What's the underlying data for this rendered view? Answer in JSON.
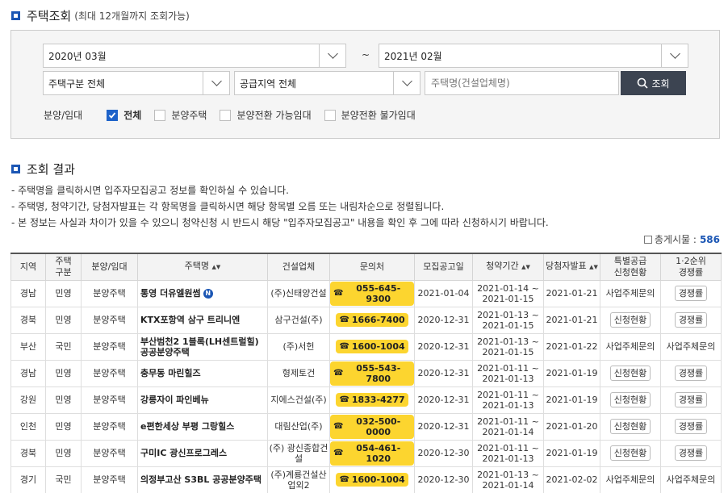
{
  "search": {
    "title": "주택조회",
    "subtitle": "(최대 12개월까지 조회가능)",
    "from_month": "2020년 03월",
    "tilde": "~",
    "to_month": "2021년 02월",
    "house_type": "주택구분 전체",
    "region": "공급지역 전체",
    "name_placeholder": "주택명(건설업체명)",
    "search_button": "조회",
    "filter_label": "분양/임대",
    "filters": [
      {
        "label": "전체",
        "checked": true
      },
      {
        "label": "분양주택",
        "checked": false
      },
      {
        "label": "분양전환 가능임대",
        "checked": false
      },
      {
        "label": "분양전환 불가임대",
        "checked": false
      }
    ]
  },
  "results": {
    "title": "조회 결과",
    "notes": [
      "- 주택명을 클릭하시면 입주자모집공고 정보를 확인하실 수 있습니다.",
      "- 주택명, 청약기간, 당첨자발표는 각 항목명을 클릭하시면 해당 항목별 오름 또는 내림차순으로 정렬됩니다.",
      "- 본 정보는 사실과 차이가 있을 수 있으니 청약신청 시 반드시 해당 \"입주자모집공고\" 내용을 확인 후 그에 따라 신청하시기 바랍니다."
    ],
    "total_label": "총게시물 :",
    "total_count": "586"
  },
  "table": {
    "headers": {
      "region": "지역",
      "type_line1": "주택",
      "type_line2": "구분",
      "sale": "분양/임대",
      "name": "주택명",
      "builder": "건설업체",
      "contact": "문의처",
      "notice": "모집공고일",
      "period": "청약기간",
      "winner": "당첨자발표",
      "special_line1": "특별공급",
      "special_line2": "신청현황",
      "rank_line1": "1·2순위",
      "rank_line2": "경쟁률",
      "sort_mark": "▲▼"
    },
    "rows": [
      {
        "region": "경남",
        "type": "민영",
        "sale": "분양주택",
        "name": "통영 더유엘원썸",
        "badge": "N",
        "builder": "(주)신태양건설",
        "phone": "055-645-9300",
        "notice": "2021-01-04",
        "period_start": "2021-01-14 ~",
        "period_end": "2021-01-15",
        "winner": "2021-01-21",
        "special": "사업주체문의",
        "special_btn": false,
        "rank": "경쟁률",
        "rank_btn": true
      },
      {
        "region": "경북",
        "type": "민영",
        "sale": "분양주택",
        "name": "KTX포항역 삼구 트리니엔",
        "badge": "",
        "builder": "삼구건설(주)",
        "phone": "1666-7400",
        "notice": "2020-12-31",
        "period_start": "2021-01-13 ~",
        "period_end": "2021-01-15",
        "winner": "2021-01-21",
        "special": "신청현황",
        "special_btn": true,
        "rank": "경쟁률",
        "rank_btn": true
      },
      {
        "region": "부산",
        "type": "국민",
        "sale": "분양주택",
        "name": "부산범천2 1블록(LH센트럴힐) 공공분양주택",
        "badge": "",
        "builder": "(주)서헌",
        "phone": "1600-1004",
        "notice": "2020-12-31",
        "period_start": "2021-01-13 ~",
        "period_end": "2021-01-15",
        "winner": "2021-01-22",
        "special": "사업주체문의",
        "special_btn": false,
        "rank": "사업주체문의",
        "rank_btn": false
      },
      {
        "region": "경남",
        "type": "민영",
        "sale": "분양주택",
        "name": "충무동 마린힐즈",
        "badge": "",
        "builder": "형제토건",
        "phone": "055-543-7800",
        "notice": "2020-12-31",
        "period_start": "2021-01-11 ~",
        "period_end": "2021-01-13",
        "winner": "2021-01-19",
        "special": "신청현황",
        "special_btn": true,
        "rank": "경쟁률",
        "rank_btn": true
      },
      {
        "region": "강원",
        "type": "민영",
        "sale": "분양주택",
        "name": "강릉자이 파인베뉴",
        "badge": "",
        "builder": "지에스건설(주)",
        "phone": "1833-4277",
        "notice": "2020-12-31",
        "period_start": "2021-01-11 ~",
        "period_end": "2021-01-13",
        "winner": "2021-01-19",
        "special": "신청현황",
        "special_btn": true,
        "rank": "경쟁률",
        "rank_btn": true
      },
      {
        "region": "인천",
        "type": "민영",
        "sale": "분양주택",
        "name": "e편한세상 부평 그랑힐스",
        "badge": "",
        "builder": "대림산업(주)",
        "phone": "032-500-0000",
        "notice": "2020-12-31",
        "period_start": "2021-01-11 ~",
        "period_end": "2021-01-14",
        "winner": "2021-01-20",
        "special": "신청현황",
        "special_btn": true,
        "rank": "경쟁률",
        "rank_btn": true
      },
      {
        "region": "경북",
        "type": "민영",
        "sale": "분양주택",
        "name": "구미IC 광신프로그레스",
        "badge": "",
        "builder": "(주) 광신종합건설",
        "phone": "054-461-1020",
        "notice": "2020-12-30",
        "period_start": "2021-01-11 ~",
        "period_end": "2021-01-13",
        "winner": "2021-01-19",
        "special": "신청현황",
        "special_btn": true,
        "rank": "경쟁률",
        "rank_btn": true
      },
      {
        "region": "경기",
        "type": "국민",
        "sale": "분양주택",
        "name": "의정부고산 S3BL 공공분양주택",
        "badge": "",
        "builder": "(주)계룡건설산업외2",
        "phone": "1600-1004",
        "notice": "2020-12-30",
        "period_start": "2021-01-13 ~",
        "period_end": "2021-01-14",
        "winner": "2021-02-02",
        "special": "사업주체문의",
        "special_btn": false,
        "rank": "사업주체문의",
        "rank_btn": false
      }
    ]
  }
}
